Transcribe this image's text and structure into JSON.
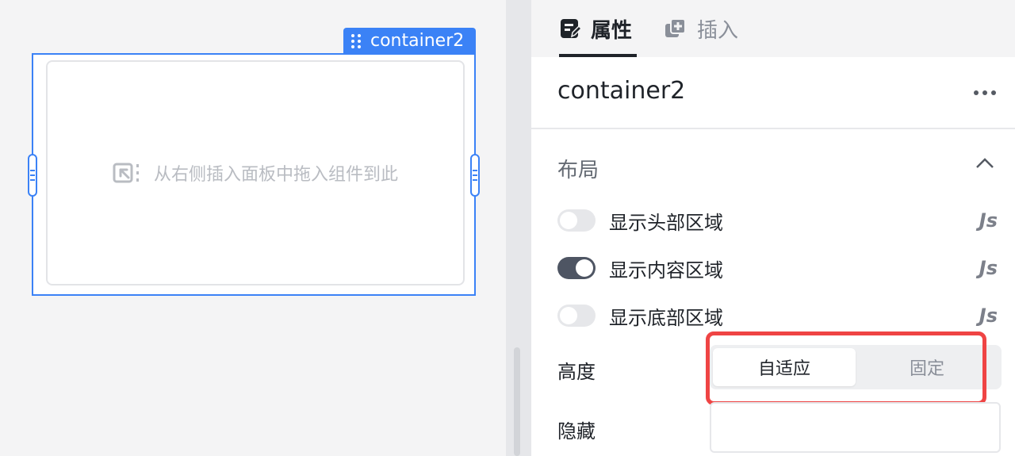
{
  "canvas": {
    "component_tag": "container2",
    "empty_hint": "从右侧插入面板中拖入组件到此"
  },
  "panel": {
    "tabs": [
      {
        "label": "属性",
        "icon": "edit-properties-icon",
        "active": true
      },
      {
        "label": "插入",
        "icon": "add-component-icon",
        "active": false
      }
    ],
    "component_name": "container2",
    "layout": {
      "title": "布局",
      "toggles": [
        {
          "label": "显示头部区域",
          "on": false,
          "js": "Js"
        },
        {
          "label": "显示内容区域",
          "on": true,
          "js": "Js"
        },
        {
          "label": "显示底部区域",
          "on": false,
          "js": "Js"
        }
      ],
      "height": {
        "label": "高度",
        "options": [
          "自适应",
          "固定"
        ],
        "selected": "自适应"
      },
      "hidden": {
        "label": "隐藏",
        "value": ""
      }
    }
  },
  "colors": {
    "accent": "#3b82f6",
    "highlight": "#ef4444"
  }
}
